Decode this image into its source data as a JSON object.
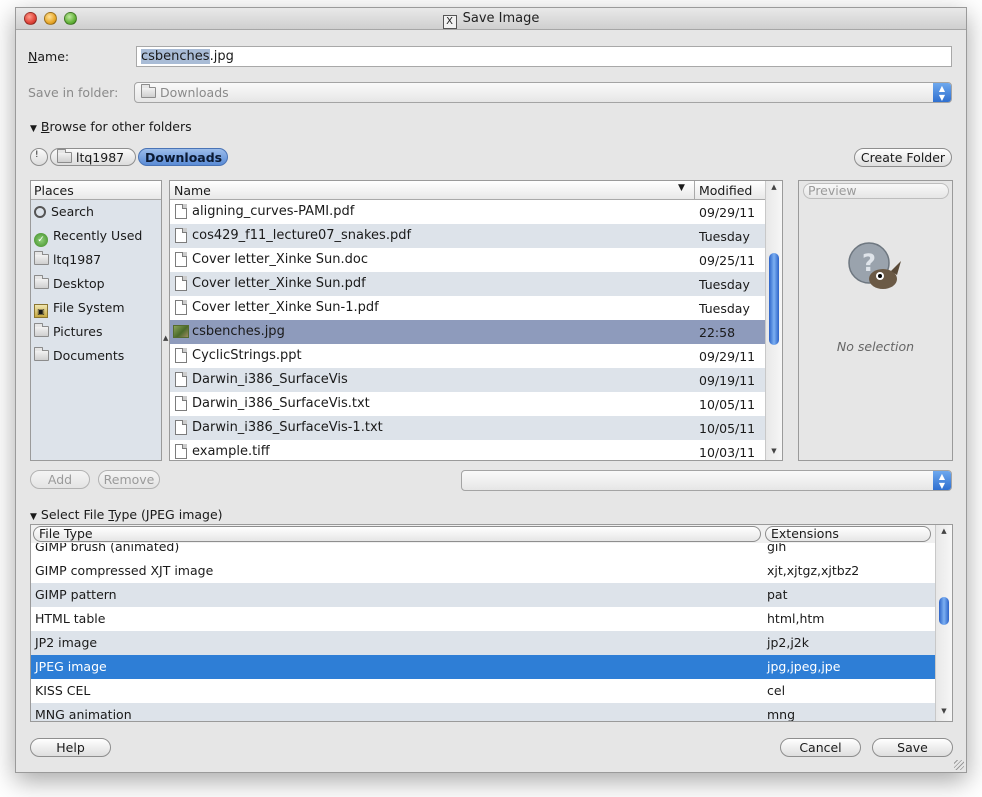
{
  "window": {
    "title": "Save Image"
  },
  "name_field": {
    "label_prefix": "",
    "label_underlined": "N",
    "label_rest": "ame:",
    "value_selected": "csbenches",
    "value_rest": ".jpg"
  },
  "save_in": {
    "label": "Save in folder:",
    "label_underlined": "f",
    "value": "Downloads"
  },
  "browse": {
    "label_u": "B",
    "label_rest": "rowse for other folders"
  },
  "path": {
    "items": [
      "ltq1987",
      "Downloads"
    ]
  },
  "create_folder": {
    "label": "Create Folder",
    "label_u": "l"
  },
  "places": {
    "header": "Places",
    "items": [
      {
        "label": "Search",
        "icon": "search-icon"
      },
      {
        "label": "Recently Used",
        "icon": "recently-used-icon"
      },
      {
        "label": "ltq1987",
        "icon": "folder-icon"
      },
      {
        "label": "Desktop",
        "icon": "folder-icon"
      },
      {
        "label": "File System",
        "icon": "hard-drive-icon"
      },
      {
        "label": "Pictures",
        "icon": "folder-icon"
      },
      {
        "label": "Documents",
        "icon": "folder-icon"
      }
    ]
  },
  "files": {
    "col_name": "Name",
    "col_modified": "Modified",
    "rows": [
      {
        "name": "aligning_curves-PAMI.pdf",
        "modified": "09/29/11"
      },
      {
        "name": "cos429_f11_lecture07_snakes.pdf",
        "modified": "Tuesday"
      },
      {
        "name": "Cover letter_Xinke Sun.doc",
        "modified": "09/25/11"
      },
      {
        "name": "Cover letter_Xinke Sun.pdf",
        "modified": "Tuesday"
      },
      {
        "name": "Cover letter_Xinke Sun-1.pdf",
        "modified": "Tuesday"
      },
      {
        "name": "csbenches.jpg",
        "modified": "22:58"
      },
      {
        "name": "CyclicStrings.ppt",
        "modified": "09/29/11"
      },
      {
        "name": "Darwin_i386_SurfaceVis",
        "modified": "09/19/11"
      },
      {
        "name": "Darwin_i386_SurfaceVis.txt",
        "modified": "10/05/11"
      },
      {
        "name": "Darwin_i386_SurfaceVis-1.txt",
        "modified": "10/05/11"
      },
      {
        "name": "example.tiff",
        "modified": "10/03/11"
      }
    ]
  },
  "preview": {
    "header": "Preview",
    "no_selection": "No selection"
  },
  "buttons": {
    "add": "Add",
    "remove": "Remove",
    "help": "Help",
    "cancel": "Cancel",
    "save": "Save"
  },
  "file_type": {
    "section_label_pre": "Select File ",
    "section_label_u": "T",
    "section_label_post": "ype (JPEG image)",
    "col_type": "File Type",
    "col_ext": "Extensions",
    "rows": [
      {
        "type": "GIMP brush (animated)",
        "ext": "gih"
      },
      {
        "type": "GIMP compressed XJT image",
        "ext": "xjt,xjtgz,xjtbz2"
      },
      {
        "type": "GIMP pattern",
        "ext": "pat"
      },
      {
        "type": "HTML table",
        "ext": "html,htm"
      },
      {
        "type": "JP2 image",
        "ext": "jp2,j2k"
      },
      {
        "type": "JPEG image",
        "ext": "jpg,jpeg,jpe"
      },
      {
        "type": "KISS CEL",
        "ext": "cel"
      },
      {
        "type": "MNG animation",
        "ext": "mng"
      }
    ]
  },
  "colors": {
    "selection": "#2e7ed6",
    "row_alt": "#dde3ea",
    "file_selected": "#8e9bbc"
  }
}
